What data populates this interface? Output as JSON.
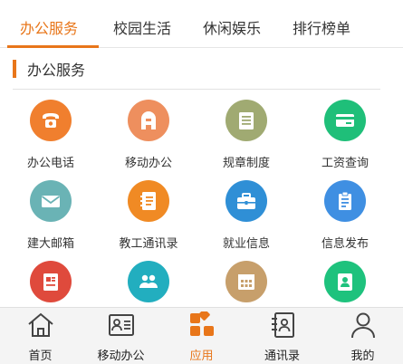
{
  "tabs": [
    {
      "label": "办公服务",
      "active": true
    },
    {
      "label": "校园生活",
      "active": false
    },
    {
      "label": "休闲娱乐",
      "active": false
    },
    {
      "label": "排行榜单",
      "active": false
    }
  ],
  "section": {
    "title": "办公服务"
  },
  "grid": [
    {
      "label": "办公电话",
      "icon": "telephone-icon",
      "color": "#f07f2e"
    },
    {
      "label": "移动办公",
      "icon": "a-letter-icon",
      "color": "#ee8f5e"
    },
    {
      "label": "规章制度",
      "icon": "document-list-icon",
      "color": "#a0aa72"
    },
    {
      "label": "工资查询",
      "icon": "credit-card-icon",
      "color": "#1fbf79"
    },
    {
      "label": "建大邮箱",
      "icon": "mail-icon",
      "color": "#6ab3b5"
    },
    {
      "label": "教工通讯录",
      "icon": "contact-book-icon",
      "color": "#f08a24"
    },
    {
      "label": "就业信息",
      "icon": "briefcase-icon",
      "color": "#2f8fd6"
    },
    {
      "label": "信息发布",
      "icon": "clipboard-icon",
      "color": "#3f8fe2"
    },
    {
      "label": "",
      "icon": "report-document-icon",
      "color": "#df4a3c"
    },
    {
      "label": "",
      "icon": "group-icon",
      "color": "#22aebf"
    },
    {
      "label": "",
      "icon": "calendar-grid-icon",
      "color": "#c79f6b"
    },
    {
      "label": "",
      "icon": "id-card-icon",
      "color": "#1ec27d"
    }
  ],
  "bottom_nav": [
    {
      "label": "首页",
      "icon": "home-icon",
      "active": false
    },
    {
      "label": "移动办公",
      "icon": "office-card-icon",
      "active": false
    },
    {
      "label": "应用",
      "icon": "apps-grid-icon",
      "active": true
    },
    {
      "label": "通讯录",
      "icon": "contacts-icon",
      "active": false
    },
    {
      "label": "我的",
      "icon": "profile-icon",
      "active": false
    }
  ],
  "colors": {
    "accent": "#e8761a"
  }
}
